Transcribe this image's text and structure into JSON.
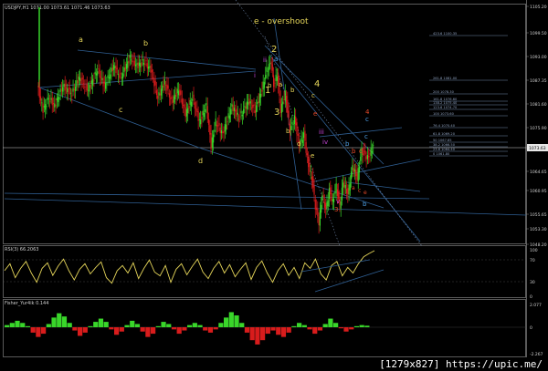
{
  "header": {
    "main": "USDJPY,H1 1071.00 1073.61 1071.46 1073.63",
    "rsi": "RSI(3) 66.2063",
    "fisher": "Fisher_Yur4ik 0.144"
  },
  "footer": {
    "text": "[1279x827] https://upic.me/"
  },
  "colors": {
    "bull": "#39d62a",
    "bear": "#d81c1c",
    "wave": "#e6d65a",
    "channel": "#2f5f93",
    "fib": "#6f86a8"
  },
  "chart_data": [
    {
      "type": "candlestick",
      "title": "",
      "y_ticks": [
        "1105.20",
        "1099.50",
        "1093.00",
        "1087.35",
        "1081.60",
        "1075.90",
        "1071.56",
        "1064.65",
        "1060.95",
        "1055.65",
        "1053.30",
        "1048.20"
      ],
      "price_label": "1073.63",
      "fib_levels": [
        "423.6 1100.35",
        "261.8 1081.00",
        "200 1078.30",
        "161.8 1076.60",
        "138.2 1075.40",
        "123.6 1074.70",
        "100 1073.60",
        "76.4 1070.40",
        "61.8 1069.20",
        "50 1067.85",
        "38.2 1066.50",
        "23.6 1064.40",
        "0 1061.80"
      ],
      "annotations": {
        "overshoot": "e - overshoot",
        "triangle": [
          "a",
          "b",
          "c",
          "d"
        ],
        "impulse": [
          "2",
          "1",
          "3",
          "4"
        ],
        "wave4": [
          "a",
          "b",
          "c",
          "d",
          "e"
        ],
        "roman": [
          "i",
          "ii",
          "iii",
          "iv",
          "v"
        ],
        "small_abc": [
          "a",
          "b",
          "c"
        ],
        "abcde_low": [
          "a",
          "c",
          "e"
        ],
        "right_targets": [
          "4",
          "c",
          "d",
          "b",
          "e"
        ],
        "lows": [
          "3",
          "b"
        ]
      },
      "price_path": [
        [
          0,
          1086
        ],
        [
          5,
          1080
        ],
        [
          10,
          1083
        ],
        [
          15,
          1081
        ],
        [
          22,
          1086
        ],
        [
          30,
          1084
        ],
        [
          36,
          1088
        ],
        [
          44,
          1085
        ],
        [
          52,
          1090
        ],
        [
          58,
          1086
        ],
        [
          66,
          1091
        ],
        [
          72,
          1088
        ],
        [
          80,
          1093
        ],
        [
          86,
          1091
        ],
        [
          92,
          1092
        ],
        [
          98,
          1090
        ],
        [
          104,
          1083
        ],
        [
          110,
          1087
        ],
        [
          116,
          1082
        ],
        [
          122,
          1085
        ],
        [
          128,
          1079
        ],
        [
          134,
          1083
        ],
        [
          140,
          1077
        ],
        [
          146,
          1081
        ],
        [
          150,
          1071
        ],
        [
          154,
          1077
        ],
        [
          160,
          1074
        ],
        [
          168,
          1081
        ],
        [
          174,
          1078
        ],
        [
          182,
          1082
        ],
        [
          188,
          1080
        ],
        [
          194,
          1085
        ],
        [
          198,
          1090
        ],
        [
          202,
          1092
        ],
        [
          204,
          1086
        ],
        [
          207,
          1089
        ],
        [
          210,
          1080
        ],
        [
          214,
          1084
        ],
        [
          218,
          1075
        ],
        [
          222,
          1078
        ],
        [
          226,
          1071
        ],
        [
          230,
          1074
        ],
        [
          234,
          1066
        ],
        [
          237,
          1063
        ],
        [
          240,
          1056
        ],
        [
          243,
          1052
        ],
        [
          246,
          1059
        ],
        [
          249,
          1055
        ],
        [
          252,
          1060
        ],
        [
          255,
          1057
        ],
        [
          258,
          1061
        ],
        [
          261,
          1056
        ],
        [
          264,
          1062
        ],
        [
          268,
          1059
        ],
        [
          272,
          1066
        ],
        [
          276,
          1063
        ],
        [
          280,
          1070
        ],
        [
          285,
          1068
        ],
        [
          290,
          1071
        ]
      ],
      "price_range": [
        1047,
        1106
      ]
    },
    {
      "type": "line",
      "title": "RSI(3) 66.2063",
      "y_ticks": [
        "100",
        "70",
        "30",
        "0"
      ],
      "values": [
        55,
        70,
        40,
        60,
        75,
        50,
        30,
        60,
        72,
        45,
        65,
        80,
        55,
        35,
        58,
        70,
        48,
        62,
        74,
        40,
        28,
        55,
        66,
        50,
        72,
        38,
        60,
        78,
        52,
        44,
        66,
        30,
        58,
        70,
        46,
        64,
        80,
        52,
        38,
        60,
        75,
        50,
        68,
        42,
        58,
        72,
        36,
        62,
        76,
        50,
        30,
        55,
        70,
        45,
        62,
        38,
        72,
        60,
        80,
        48,
        35,
        66,
        75,
        44,
        62,
        50,
        70,
        85,
        92,
        98
      ],
      "ylim": [
        0,
        100
      ]
    },
    {
      "type": "bar",
      "title": "Fisher_Yur4ik 0.144",
      "y_ticks": [
        "2.077",
        "0",
        "-2.267"
      ],
      "values": [
        0.2,
        0.4,
        0.6,
        0.4,
        0.1,
        -0.5,
        -0.9,
        -0.6,
        0.3,
        0.9,
        1.3,
        1.0,
        0.4,
        -0.3,
        -0.8,
        -0.5,
        0.1,
        0.5,
        0.8,
        0.5,
        -0.2,
        -0.7,
        -0.4,
        0.2,
        0.6,
        0.3,
        -0.4,
        -0.9,
        -0.6,
        0.1,
        0.5,
        0.3,
        -0.2,
        -0.6,
        -0.3,
        0.2,
        0.4,
        0.2,
        -0.3,
        -0.5,
        -0.2,
        0.4,
        0.9,
        1.4,
        1.1,
        0.4,
        -0.5,
        -1.2,
        -1.6,
        -1.2,
        -0.6,
        -0.3,
        -0.7,
        -0.9,
        -0.5,
        0.1,
        0.4,
        0.2,
        -0.2,
        -0.6,
        -0.3,
        0.3,
        0.8,
        0.4,
        -0.1,
        -0.4,
        -0.2,
        0.1,
        0.2,
        0.144
      ],
      "ylim": [
        -2.267,
        2.077
      ]
    }
  ]
}
